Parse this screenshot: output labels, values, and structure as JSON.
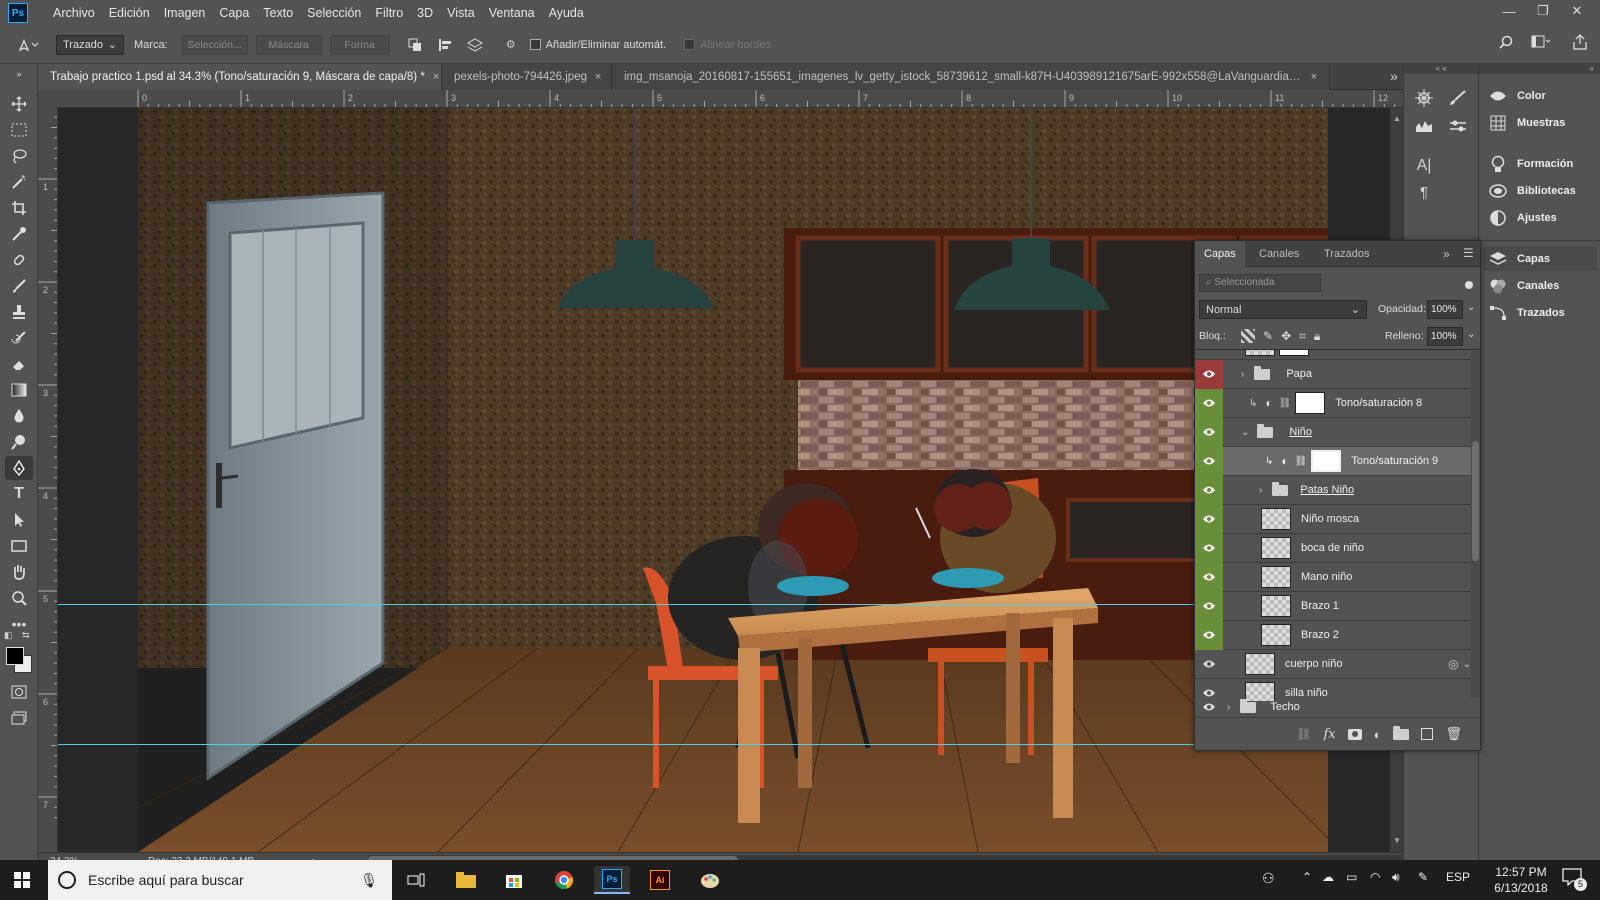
{
  "app": {
    "logo": "Ps"
  },
  "menu": [
    "Archivo",
    "Edición",
    "Imagen",
    "Capa",
    "Texto",
    "Selección",
    "Filtro",
    "3D",
    "Vista",
    "Ventana",
    "Ayuda"
  ],
  "window_controls": {
    "minimize": "—",
    "restore": "❐",
    "close": "✕"
  },
  "options": {
    "tool_mode": "Trazado",
    "marca_label": "Marca:",
    "seleccion_btn": "Selección...",
    "mascara_btn": "Máscara",
    "forma_btn": "Forma",
    "auto_add_label": "Añadir/Eliminar automát.",
    "align_edges_label": "Alinear bordes"
  },
  "tabs": [
    {
      "title": "Trabajo practico 1.psd al 34.3% (Tono/saturación 9, Máscara de capa/8) *",
      "active": true
    },
    {
      "title": "pexels-photo-794426.jpeg",
      "active": false
    },
    {
      "title": "img_msanoja_20160817-155651_imagenes_lv_getty_istock_58739612_small-k87H-U403989121675arE-992x558@LaVanguardia-Web.jpg",
      "active": false
    }
  ],
  "tab_close": "×",
  "tab_overflow": "»",
  "ruler_h": [
    "0",
    "1",
    "2",
    "3",
    "4",
    "5",
    "6",
    "7",
    "8",
    "9",
    "10",
    "11",
    "12"
  ],
  "ruler_v": [
    "1",
    "2",
    "3",
    "4",
    "5",
    "6",
    "7"
  ],
  "status": {
    "zoom": "34.3%",
    "doc": "Doc: 23.3 MB/149.1 MB",
    "arrow": "›"
  },
  "right_panel": {
    "items": [
      {
        "label": "Color",
        "icon": "color-icon"
      },
      {
        "label": "Muestras",
        "icon": "swatches-icon"
      },
      {
        "label": "Formación",
        "icon": "learn-icon"
      },
      {
        "label": "Bibliotecas",
        "icon": "libraries-icon"
      },
      {
        "label": "Ajustes",
        "icon": "adjustments-icon"
      },
      {
        "label": "Capas",
        "icon": "layers-icon"
      },
      {
        "label": "Canales",
        "icon": "channels-icon"
      },
      {
        "label": "Trazados",
        "icon": "paths-icon"
      }
    ]
  },
  "layers_panel": {
    "tabs": [
      "Capas",
      "Canales",
      "Trazados"
    ],
    "filter_placeholder": "Seleccionada",
    "blend_mode": "Normal",
    "opacity_label": "Opacidad:",
    "opacity": "100%",
    "lock_label": "Bloq.:",
    "fill_label": "Relleno:",
    "fill": "100%",
    "fx_label": "fx",
    "layers": [
      {
        "name": "Papa",
        "type": "group",
        "eye": "red",
        "indent": 1
      },
      {
        "name": "Tono/saturación 8",
        "type": "adjustment",
        "eye": "green",
        "indent": 2
      },
      {
        "name": "Niño",
        "type": "group-open",
        "eye": "green",
        "indent": 1
      },
      {
        "name": "Tono/saturación 9",
        "type": "adjustment",
        "eye": "green",
        "indent": 2,
        "selected": true
      },
      {
        "name": "Patas Niño",
        "type": "group",
        "eye": "green",
        "indent": 2
      },
      {
        "name": "Niño mosca",
        "type": "pixel",
        "eye": "green",
        "indent": 2
      },
      {
        "name": "boca de niño",
        "type": "pixel",
        "eye": "green",
        "indent": 2
      },
      {
        "name": "Mano niño",
        "type": "pixel",
        "eye": "green",
        "indent": 2
      },
      {
        "name": "Brazo 1",
        "type": "pixel",
        "eye": "green",
        "indent": 2
      },
      {
        "name": "Brazo 2",
        "type": "pixel",
        "eye": "green",
        "indent": 2
      },
      {
        "name": "cuerpo niño",
        "type": "smart",
        "eye": "none",
        "indent": 1
      },
      {
        "name": "silla niño",
        "type": "smart",
        "eye": "none",
        "indent": 1
      },
      {
        "name": "Techo",
        "type": "group",
        "eye": "none",
        "indent": 0
      }
    ]
  },
  "taskbar": {
    "search_placeholder": "Escribe aquí para buscar",
    "language": "ESP",
    "time": "12:57 PM",
    "date": "6/13/2018",
    "notifications": "5"
  },
  "colors": {
    "accent": "#31a8ff",
    "eye_green": "#6a8f3a",
    "eye_red": "#9a3a3a",
    "guide": "#46d2e6"
  }
}
